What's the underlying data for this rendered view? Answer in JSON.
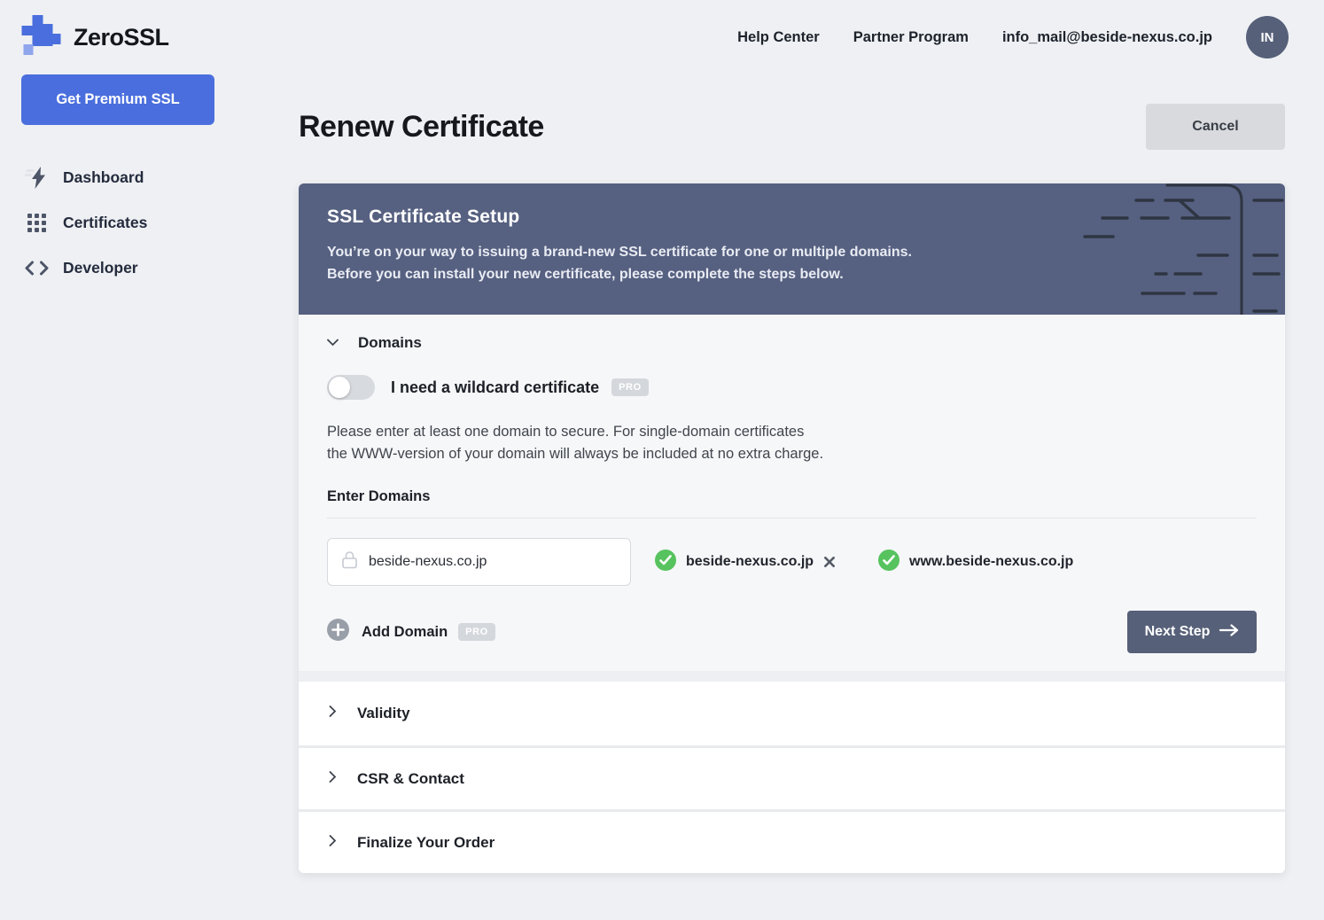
{
  "colors": {
    "brand_blue": "#4a6edd",
    "slate_panel": "#566080",
    "green_check": "#57c35e",
    "page_background": "#eef0f3"
  },
  "topbar": {
    "logo_text": "ZeroSSL",
    "nav_items": [
      {
        "label": "Help Center"
      },
      {
        "label": "Partner Program"
      }
    ],
    "email": "info_mail@beside-nexus.co.jp",
    "avatar_initials": "IN"
  },
  "sidebar": {
    "premium_button_label": "Get Premium SSL",
    "items": [
      {
        "label": "Dashboard",
        "icon": "lightning-icon"
      },
      {
        "label": "Certificates",
        "icon": "grid-icon"
      },
      {
        "label": "Developer",
        "icon": "code-icon"
      }
    ]
  },
  "page": {
    "title": "Renew Certificate",
    "cancel_button_label": "Cancel"
  },
  "setup_panel": {
    "title": "SSL Certificate Setup",
    "intro_line1": "You’re on your way to issuing a brand-new SSL certificate for one or multiple domains.",
    "intro_line2": "Before you can install your new certificate, please complete the steps below.",
    "domains": {
      "section_label": "Domains",
      "wildcard_label": "I need a wildcard certificate",
      "wildcard_pro_badge": "PRO",
      "wildcard_toggle_state": "off",
      "note_line1": "Please enter at least one domain to secure. For single-domain certificates",
      "note_line2": "the WWW-version of your domain will always be included at no extra charge.",
      "enter_domains_label": "Enter Domains",
      "domain_input_value": "beside-nexus.co.jp",
      "verified_domains": [
        {
          "label": "beside-nexus.co.jp",
          "removable": true
        },
        {
          "label": "www.beside-nexus.co.jp",
          "removable": false
        }
      ],
      "add_domain_label": "Add Domain",
      "add_domain_pro_badge": "PRO",
      "next_step_label": "Next Step"
    },
    "collapsed_sections": [
      {
        "label": "Validity"
      },
      {
        "label": "CSR & Contact"
      },
      {
        "label": "Finalize Your Order"
      }
    ]
  }
}
